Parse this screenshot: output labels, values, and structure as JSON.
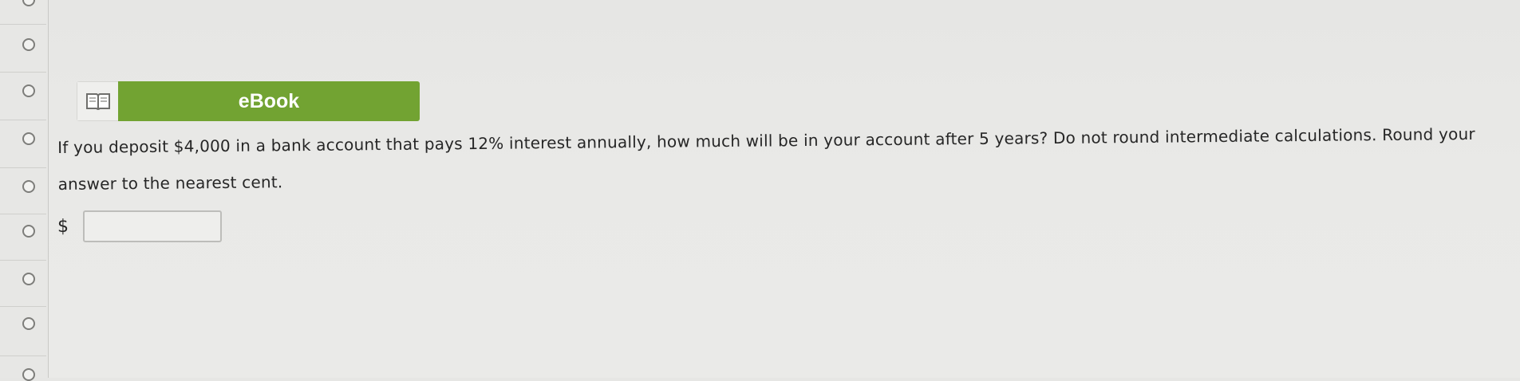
{
  "nav": {
    "radio_count": 8
  },
  "ebook": {
    "icon": "book-icon",
    "label": "eBook",
    "color": "#72a332"
  },
  "question": {
    "text": "If you deposit $4,000 in a bank account that pays 12% interest annually, how much will be in your account after 5 years? Do not round intermediate calculations. Round your answer to the nearest cent."
  },
  "answer": {
    "currency_symbol": "$",
    "value": "",
    "placeholder": ""
  }
}
